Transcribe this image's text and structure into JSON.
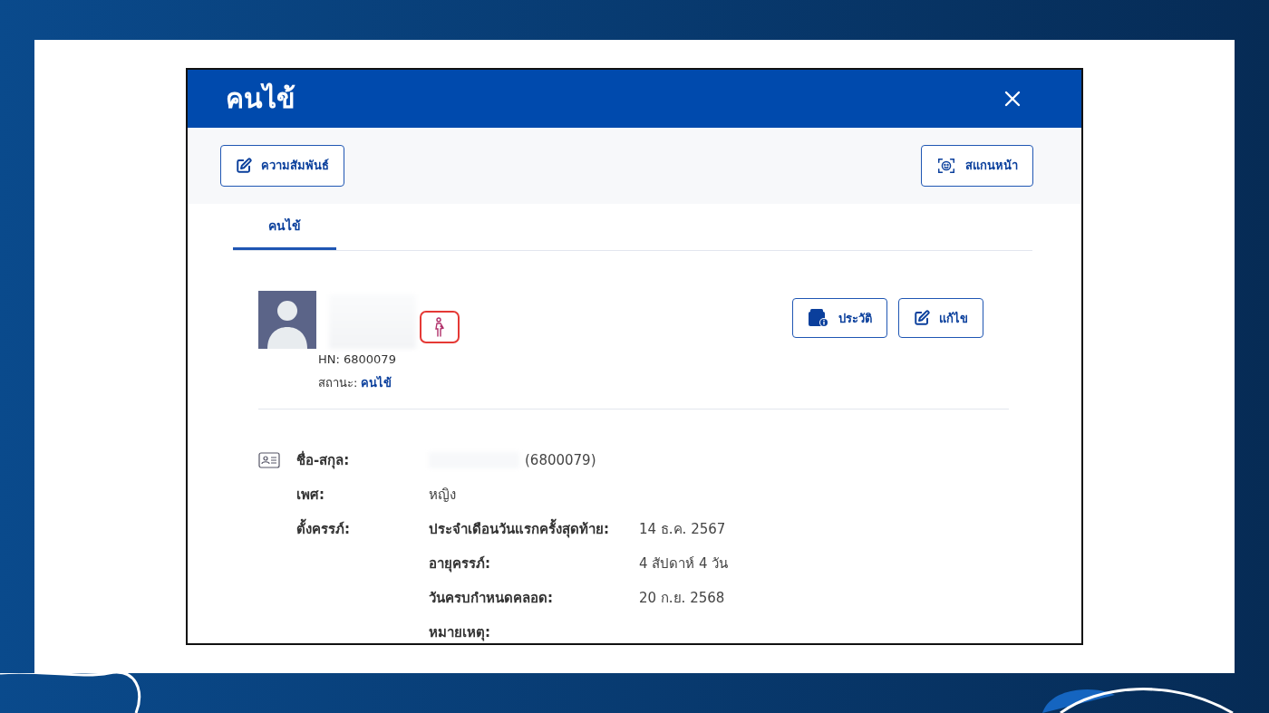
{
  "dialog": {
    "title": "คนไข้"
  },
  "toolbar": [
    {
      "label": "ความสัมพันธ์",
      "kind": "edit"
    },
    {
      "label": "สแกนหน้า",
      "kind": "face-scan"
    }
  ],
  "tabs": [
    {
      "label": "คนไข้",
      "selected": true
    }
  ],
  "patient": {
    "hn": "HN: 6800079",
    "status_label": "สถานะ:",
    "status_value": "คนไข้",
    "pregnant": true
  },
  "actions": [
    {
      "label": "ประวัติ",
      "kind": "history"
    },
    {
      "label": "แก้ไข",
      "kind": "edit"
    }
  ],
  "details": {
    "name_label": "ชื่อ-สกุล:",
    "name_value": "(6800079)",
    "sex_label": "เพศ:",
    "sex_value": "หญิง",
    "pregnancy_label": "ตั้งครรภ์:",
    "pregnancy_rows": [
      {
        "label": "ประจำเดือนวันแรกครั้งสุดท้าย:",
        "value": "14 ธ.ค. 2567"
      },
      {
        "label": "อายุครรภ์:",
        "value": "4 สัปดาห์ 4 วัน"
      },
      {
        "label": "วันครบกำหนดคลอด:",
        "value": "20 ก.ย. 2568"
      },
      {
        "label": "หมายเหตุ:"
      }
    ]
  }
}
